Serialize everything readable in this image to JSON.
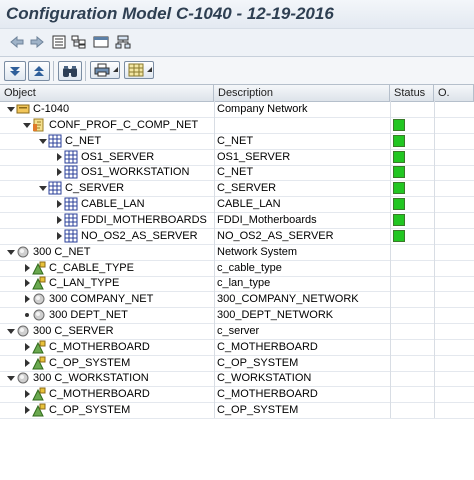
{
  "window": {
    "title": "Configuration Model C-1040 - 12-19-2016"
  },
  "columns": {
    "object": "Object",
    "description": "Description",
    "status": "Status",
    "other": "O."
  },
  "colors": {
    "status_ok": "#22c622",
    "accent": "#2e3f52"
  },
  "rows": [
    {
      "label": "C-1040",
      "desc": "Company Network",
      "level": 0,
      "expand": "down",
      "icon": "root-configuration-icon",
      "status": false
    },
    {
      "label": "CONF_PROF_C_COMP_NET",
      "desc": "",
      "level": 1,
      "expand": "down",
      "icon": "config-profile-icon",
      "status": true
    },
    {
      "label": "C_NET",
      "desc": "C_NET",
      "level": 2,
      "expand": "down",
      "icon": "class-icon",
      "status": true
    },
    {
      "label": "OS1_SERVER",
      "desc": "OS1_SERVER",
      "level": 3,
      "expand": "right",
      "icon": "class-icon",
      "status": true
    },
    {
      "label": "OS1_WORKSTATION",
      "desc": "C_NET",
      "level": 3,
      "expand": "right",
      "icon": "class-icon",
      "status": true
    },
    {
      "label": "C_SERVER",
      "desc": "C_SERVER",
      "level": 2,
      "expand": "down",
      "icon": "class-icon",
      "status": true
    },
    {
      "label": "CABLE_LAN",
      "desc": "CABLE_LAN",
      "level": 3,
      "expand": "right",
      "icon": "class-icon",
      "status": true
    },
    {
      "label": "FDDI_MOTHERBOARDS",
      "desc": "FDDI_Motherboards",
      "level": 3,
      "expand": "right",
      "icon": "class-icon",
      "status": true
    },
    {
      "label": "NO_OS2_AS_SERVER",
      "desc": "NO_OS2_AS_SERVER",
      "level": 3,
      "expand": "right",
      "icon": "class-icon",
      "status": true
    },
    {
      "label": "300 C_NET",
      "desc": "Network System",
      "level": 0,
      "expand": "down",
      "icon": "circle-icon",
      "status": false
    },
    {
      "label": "C_CABLE_TYPE",
      "desc": "c_cable_type",
      "level": 1,
      "expand": "right",
      "icon": "characteristic-icon",
      "status": false
    },
    {
      "label": "C_LAN_TYPE",
      "desc": "c_lan_type",
      "level": 1,
      "expand": "right",
      "icon": "characteristic-icon",
      "status": false
    },
    {
      "label": "300 COMPANY_NET",
      "desc": "300_COMPANY_NETWORK",
      "level": 1,
      "expand": "right",
      "icon": "circle-icon",
      "status": false
    },
    {
      "label": "300 DEPT_NET",
      "desc": "300_DEPT_NETWORK",
      "level": 1,
      "expand": "bullet",
      "icon": "circle-icon",
      "status": false
    },
    {
      "label": "300 C_SERVER",
      "desc": "c_server",
      "level": 0,
      "expand": "down",
      "icon": "circle-icon",
      "status": false
    },
    {
      "label": "C_MOTHERBOARD",
      "desc": "C_MOTHERBOARD",
      "level": 1,
      "expand": "right",
      "icon": "characteristic-icon",
      "status": false
    },
    {
      "label": "C_OP_SYSTEM",
      "desc": "C_OP_SYSTEM",
      "level": 1,
      "expand": "right",
      "icon": "characteristic-icon",
      "status": false
    },
    {
      "label": "300 C_WORKSTATION",
      "desc": "C_WORKSTATION",
      "level": 0,
      "expand": "down",
      "icon": "circle-icon",
      "status": false
    },
    {
      "label": "C_MOTHERBOARD",
      "desc": "C_MOTHERBOARD",
      "level": 1,
      "expand": "right",
      "icon": "characteristic-icon",
      "status": false
    },
    {
      "label": "C_OP_SYSTEM",
      "desc": "C_OP_SYSTEM",
      "level": 1,
      "expand": "right",
      "icon": "characteristic-icon",
      "status": false
    }
  ]
}
